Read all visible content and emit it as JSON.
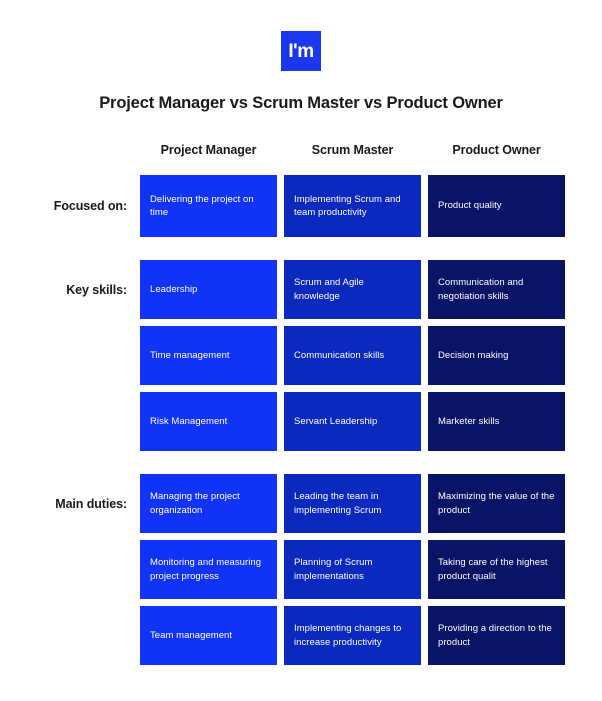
{
  "logo": {
    "text": "I'm",
    "color": "#1a38f0"
  },
  "title": "Project Manager vs Scrum Master vs Product Owner",
  "columns": [
    {
      "label": "Project Manager",
      "color": "#1133f5"
    },
    {
      "label": "Scrum Master",
      "color": "#0b28bf"
    },
    {
      "label": "Product Owner",
      "color": "#0a1466"
    }
  ],
  "sections": [
    {
      "label": "Focused on:",
      "rows": [
        {
          "project_manager": "Delivering the project on time",
          "scrum_master": "Implementing Scrum and team productivity",
          "product_owner": "Product quality"
        }
      ]
    },
    {
      "label": "Key skills:",
      "rows": [
        {
          "project_manager": "Leadership",
          "scrum_master": "Scrum and Agile knowledge",
          "product_owner": "Communication and negotiation skills"
        },
        {
          "project_manager": "Time management",
          "scrum_master": "Communication skills",
          "product_owner": "Decision making"
        },
        {
          "project_manager": "Risk Management",
          "scrum_master": "Servant Leadership",
          "product_owner": "Marketer skills"
        }
      ]
    },
    {
      "label": "Main duties:",
      "rows": [
        {
          "project_manager": "Managing the project organization",
          "scrum_master": "Leading the team in implementing Scrum",
          "product_owner": "Maximizing the value of the product"
        },
        {
          "project_manager": "Monitoring and measuring project progress",
          "scrum_master": "Planning of Scrum implementations",
          "product_owner": "Taking care of the highest product qualit"
        },
        {
          "project_manager": "Team management",
          "scrum_master": "Implementing changes to increase productivity",
          "product_owner": "Providing a direction to the product"
        }
      ]
    }
  ]
}
